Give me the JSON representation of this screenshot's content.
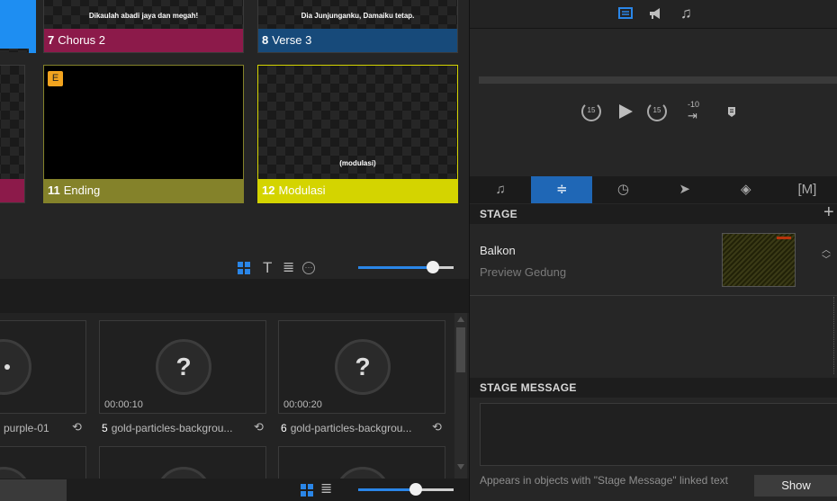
{
  "slides": {
    "top_row": [
      {
        "number": "7",
        "name": "Chorus 2",
        "lyric_line1": "",
        "lyric_line2": "Dikaulah abadi jaya dan megah!",
        "color": "#8c1a4a"
      },
      {
        "number": "8",
        "name": "Verse 3",
        "lyric_line1": "",
        "lyric_line2": "Dia Junjunganku, Damaiku tetap.",
        "color": "#174a7a"
      }
    ],
    "bottom_row": [
      {
        "number": "11",
        "name": "Ending",
        "badge": "E",
        "color": "#84822a"
      },
      {
        "number": "12",
        "name": "Modulasi",
        "caption": "(modulasi)",
        "color": "#d4d400"
      }
    ]
  },
  "slide_view_toolbar": {
    "icons": [
      "grid-icon",
      "text-icon",
      "list-icon",
      "more-icon"
    ],
    "zoom_percent": 78
  },
  "media_bin": {
    "items": [
      {
        "number": "",
        "name": "purple-01",
        "duration": "",
        "truncated_label": "purple-01"
      },
      {
        "number": "5",
        "name": "gold-particles-backgrou...",
        "duration": "00:00:10"
      },
      {
        "number": "6",
        "name": "gold-particles-backgrou...",
        "duration": "00:00:20"
      }
    ],
    "zoom_percent": 60
  },
  "audio_panel": {
    "top_icons": [
      "slides-icon",
      "announcement-icon",
      "music-icon"
    ],
    "skip_back": "15",
    "skip_forward": "15",
    "offset_label": "-10"
  },
  "tabs": [
    "music-tab",
    "stage-tab",
    "timer-tab",
    "messages-tab",
    "props-tab",
    "macros-tab"
  ],
  "tab_macros_label": "[M]",
  "stage": {
    "header": "STAGE",
    "add": "+",
    "screen_name": "Balkon",
    "layout_name": "Preview Gedung"
  },
  "stage_message": {
    "header": "STAGE MESSAGE",
    "value": "",
    "hint": "Appears in objects with \"Stage Message\" linked text",
    "show_label": "Show"
  },
  "colors": {
    "accent_blue": "#1f67b6",
    "selection_blue": "#1e8ef2",
    "badge_orange": "#f2a41f"
  }
}
